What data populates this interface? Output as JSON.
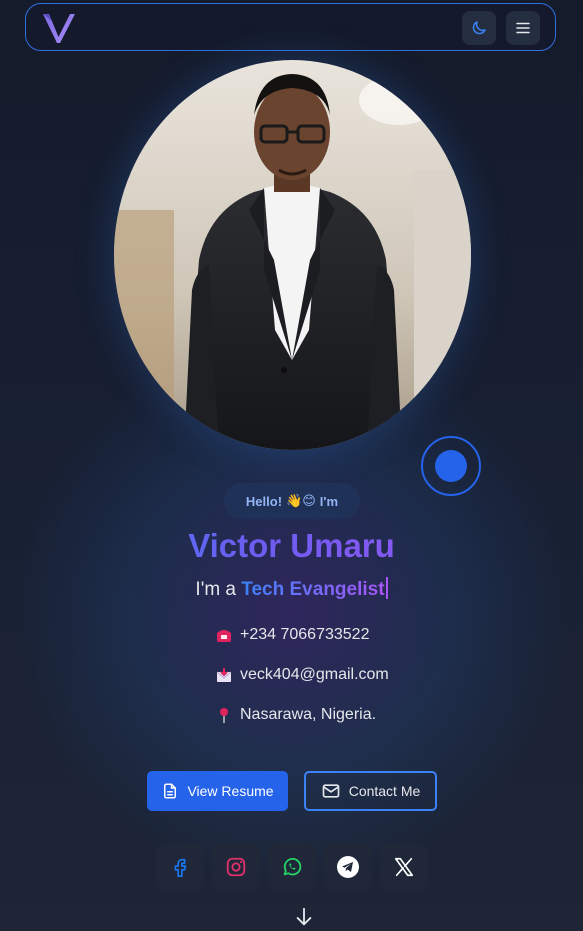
{
  "navbar": {
    "logo_letter": "V",
    "icons": {
      "theme": "moon-icon",
      "menu": "hamburger-menu-icon"
    }
  },
  "profile": {
    "photo_alt": "Victor Umaru portrait",
    "greeting": "Hello!",
    "greeting_emoji": "👋😊",
    "greeting_suffix": "I'm",
    "name": "Victor Umaru",
    "role_prefix": "I'm a",
    "role": "Tech Evangelist"
  },
  "contacts": [
    {
      "icon": "phone-icon",
      "glyph": "☎",
      "text": "+234 7066733522"
    },
    {
      "icon": "mail-icon",
      "glyph": "📩",
      "text": "veck404@gmail.com"
    },
    {
      "icon": "location-pin-icon",
      "glyph": "📍",
      "text": "Nasarawa, Nigeria."
    }
  ],
  "buttons": {
    "resume": "View Resume",
    "contact": "Contact Me"
  },
  "socials": [
    "facebook-icon",
    "instagram-icon",
    "whatsapp-icon",
    "telegram-icon",
    "x-icon"
  ],
  "colors": {
    "accent": "#2563eb",
    "gradient_start": "#3b82f6",
    "gradient_end": "#a855f7",
    "background": "#141b2b"
  }
}
